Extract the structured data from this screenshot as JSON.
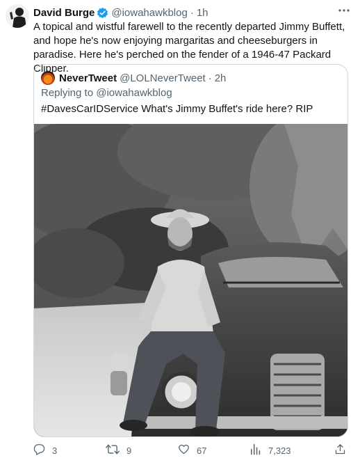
{
  "tweet": {
    "author_name": "David Burge",
    "handle": "@iowahawkblog",
    "separator": "·",
    "time": "1h",
    "text": "A topical and wistful farewell to the recently departed Jimmy Buffett, and hope he's now enjoying margaritas and cheeseburgers in paradise. Here he's perched on the fender of a 1946-47 Packard Clipper.",
    "verified_color": "#1d9bf0"
  },
  "quoted": {
    "author_name": "NeverTweet",
    "handle": "@LOLNeverTweet",
    "separator": "·",
    "time": "2h",
    "replying_to": "Replying to @iowahawkblog",
    "text": "#DavesCarIDService What's Jimmy Buffet's ride here? RIP"
  },
  "actions": {
    "replies": "3",
    "retweets": "9",
    "likes": "67",
    "views": "7,323"
  },
  "icons": [
    "verified-badge-icon",
    "more-icon",
    "reply-icon",
    "retweet-icon",
    "like-icon",
    "views-icon",
    "share-icon"
  ]
}
